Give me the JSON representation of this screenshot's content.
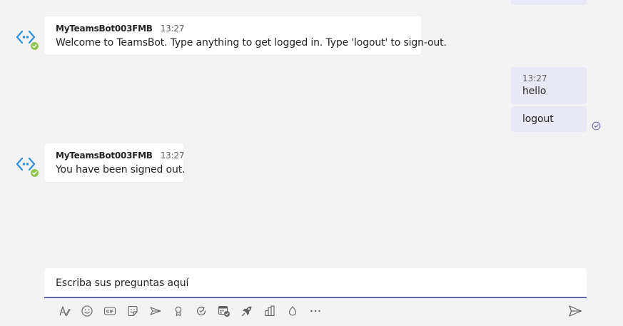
{
  "messages": [
    {
      "sender": "MyTeamsBot003FMB",
      "time": "13:27",
      "text": "Welcome to TeamsBot. Type anything to get logged in. Type 'logout' to sign-out."
    },
    {
      "time": "13:27",
      "text": "hello"
    },
    {
      "text": "logout"
    },
    {
      "sender": "MyTeamsBot003FMB",
      "time": "13:27",
      "text": "You have been signed out."
    }
  ],
  "compose": {
    "text": "Escriba sus preguntas aquí"
  },
  "toolbar": {
    "icons": [
      "format-icon",
      "emoji-icon",
      "gif-icon",
      "sticker-icon",
      "meet-now-icon",
      "praise-icon",
      "loop-icon",
      "schedule-icon",
      "app-icon",
      "insights-icon",
      "bulb-icon",
      "more-options-icon"
    ],
    "send_icon": "send-icon"
  },
  "colors": {
    "background": "#f3f3f3",
    "bot_bubble": "#ffffff",
    "my_bubble": "#e8e8f7",
    "accent": "#6264a7",
    "presence": "#92c353",
    "bot_icon": "#2f8ed9"
  }
}
